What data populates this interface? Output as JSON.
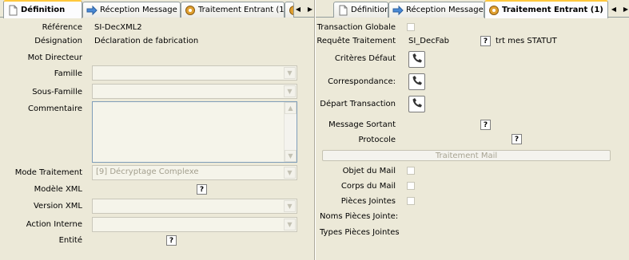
{
  "left": {
    "tabs": [
      {
        "label": "Définition",
        "icon": "document-icon",
        "active": true
      },
      {
        "label": "Réception Message",
        "icon": "arrow-right-icon",
        "active": false
      },
      {
        "label": "Traitement Entrant (1)",
        "icon": "gear-icon",
        "active": false
      }
    ],
    "labels": {
      "reference": "Référence",
      "designation": "Désignation",
      "mot_directeur": "Mot Directeur",
      "famille": "Famille",
      "sous_famille": "Sous-Famille",
      "commentaire": "Commentaire",
      "mode_traitement": "Mode Traitement",
      "modele_xml": "Modèle XML",
      "version_xml": "Version XML",
      "action_interne": "Action Interne",
      "entite": "Entité"
    },
    "values": {
      "reference": "SI-DecXML2",
      "designation": "Déclaration de fabrication",
      "famille": "",
      "sous_famille": "",
      "mode_traitement": "[9] Décryptage Complexe",
      "version_xml": "",
      "action_interne": ""
    },
    "help_label": "?"
  },
  "right": {
    "tabs": [
      {
        "label": "Définition",
        "icon": "document-icon",
        "active": false
      },
      {
        "label": "Réception Message",
        "icon": "arrow-right-icon",
        "active": false
      },
      {
        "label": "Traitement Entrant (1)",
        "icon": "gear-icon",
        "active": true
      }
    ],
    "labels": {
      "transaction_globale": "Transaction Globale",
      "requete_traitement": "Requête Traitement",
      "criteres_defaut": "Critères Défaut",
      "correspondance": "Correspondance:",
      "depart_transaction": "Départ Transaction",
      "message_sortant": "Message Sortant",
      "protocole": "Protocole",
      "traitement_mail": "Traitement Mail",
      "objet_mail": "Objet du Mail",
      "corps_mail": "Corps du Mail",
      "pieces_jointes": "Pièces Jointes",
      "noms_pieces_jointes": "Noms Pièces Jointe:",
      "types_pieces_jointes": "Types Pièces Jointes"
    },
    "values": {
      "requete_traitement": "SI_DecFab",
      "requete_desc": "trt mes STATUT"
    },
    "help_label": "?"
  }
}
